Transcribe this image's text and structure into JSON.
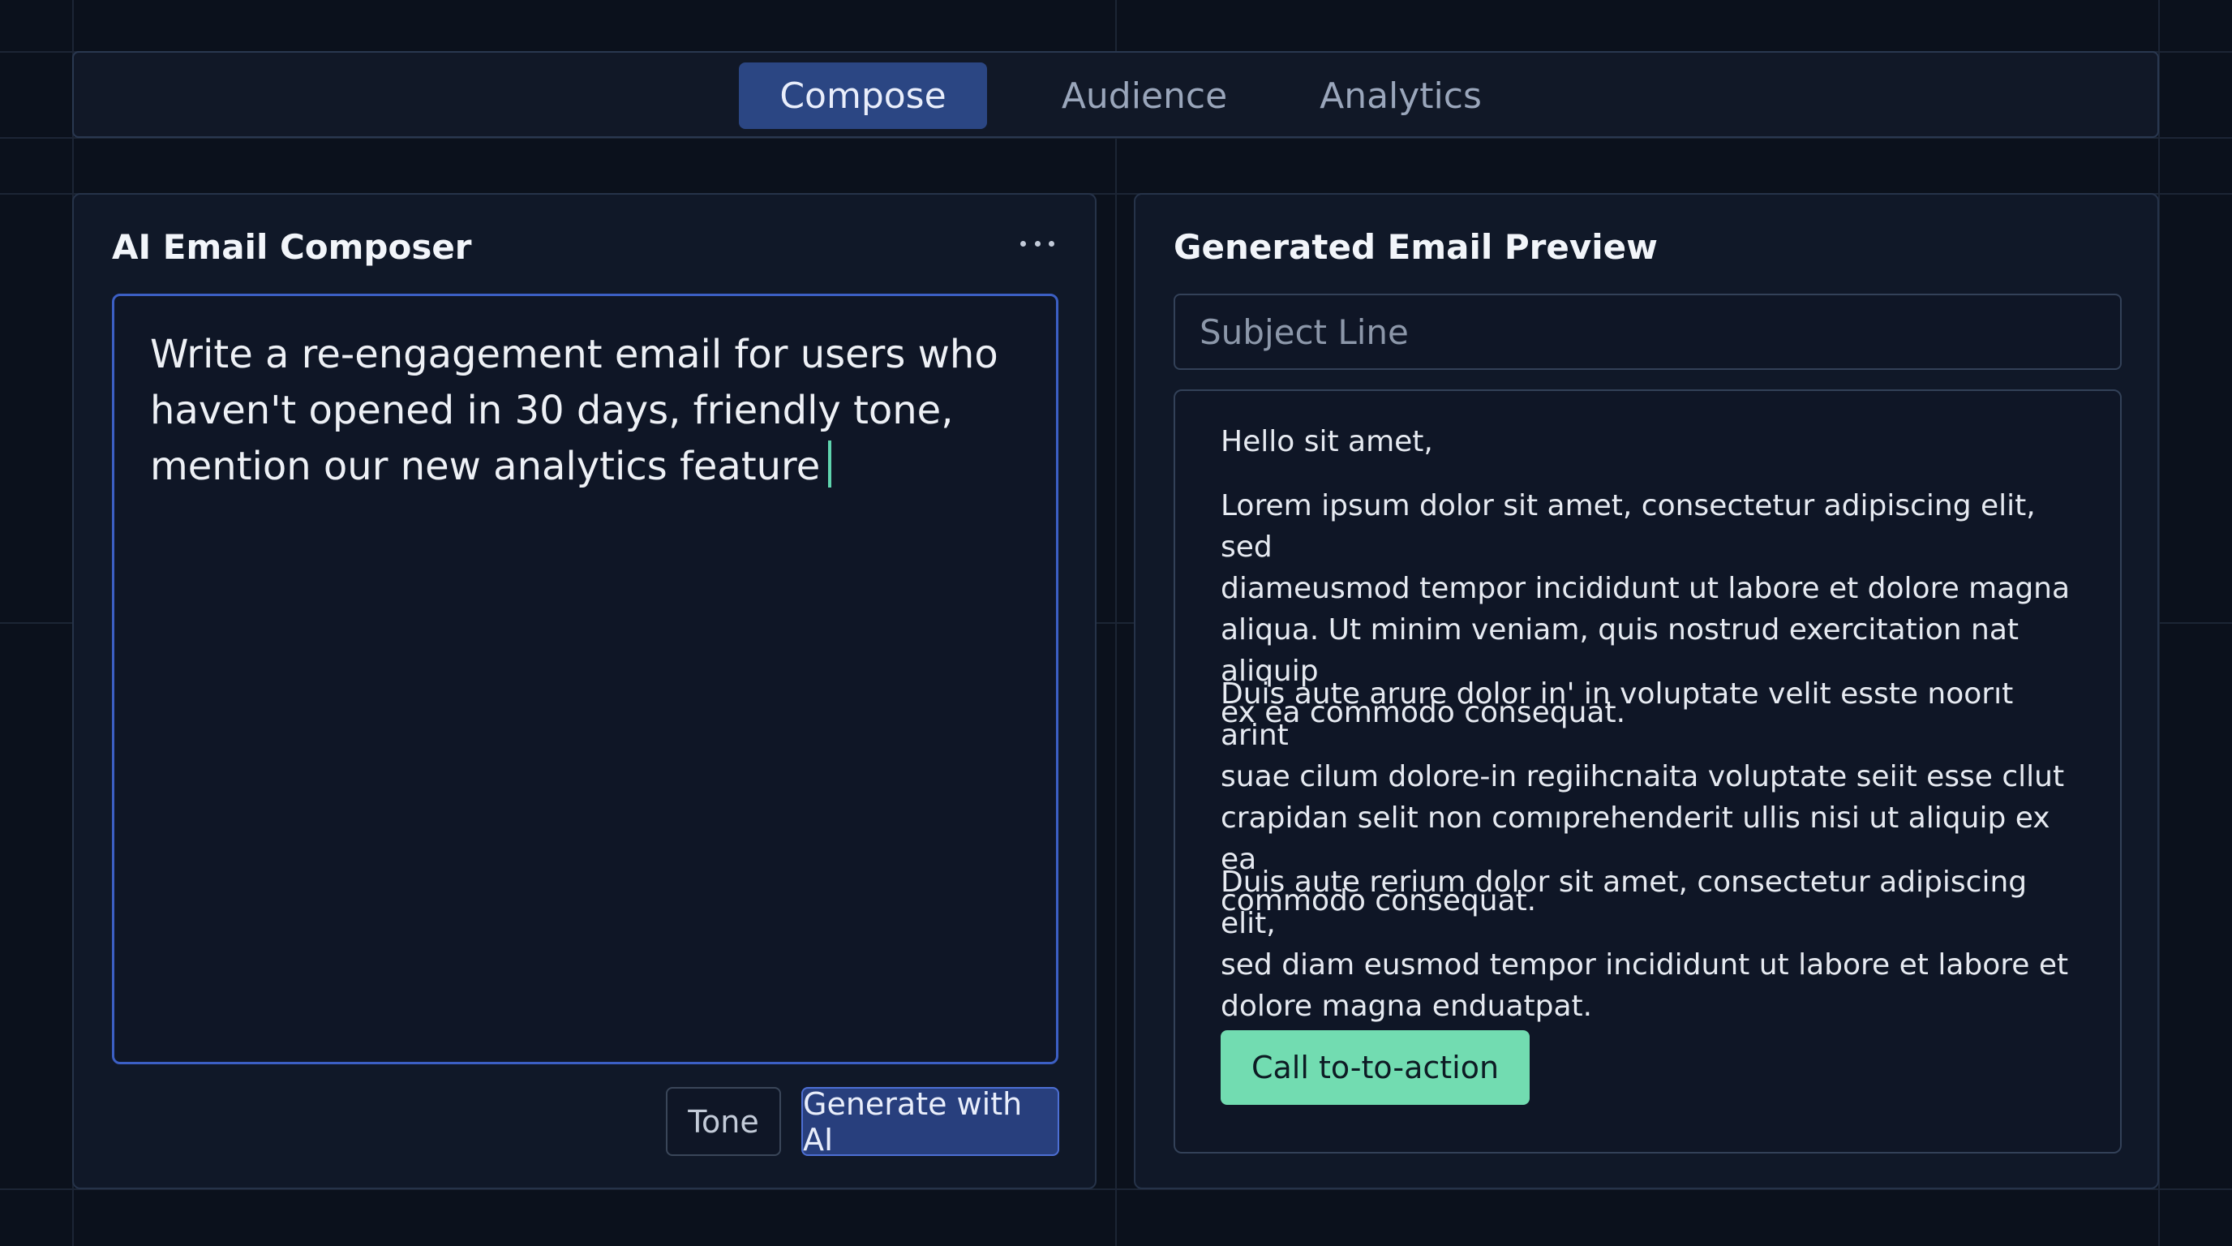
{
  "tabs": [
    {
      "label": "Compose",
      "active": true
    },
    {
      "label": "Audience",
      "active": false
    },
    {
      "label": "Analytics",
      "active": false
    }
  ],
  "composer": {
    "title": "AI Email Composer",
    "menu_icon": "more-horizontal-icon",
    "prompt_lines": [
      "Write a re-engagement email for users who",
      "haven't opened in 30 days, friendly tone,",
      "mention our new analytics feature"
    ],
    "tone_label": "Tone",
    "generate_label": "Generate with AI"
  },
  "preview": {
    "title": "Generated Email Preview",
    "subject_placeholder": "Subject Line",
    "greeting": "Hello sit amet,",
    "paragraph_1_lines": [
      "Lorem ipsum dolor sit amet, consectetur adipiscing elit, sed",
      "diameusmod tempor incididunt ut labore et dolore magna",
      "aliqua. Ut minim veniam, quis nostrud exercitation nat aliquip",
      "ex ea commodo consequat."
    ],
    "paragraph_2_lines": [
      "Duis aute arure dolor in' in voluptate velit esste noorıt arint",
      "suae cilum dolore-in regiihcnaita voluptate seiit esse cllut",
      "crapidan selit non comıprehenderit ullis nisi ut aliquip ex ea",
      "commodo consequat."
    ],
    "paragraph_3_lines": [
      "Duis aute rerium dolor sit amet, consectetur adipiscing elit,",
      "sed diam eusmod tempor incididunt ut labore et labore et",
      "dolore magna enduatpat."
    ],
    "cta_label": "Call to-to-action"
  },
  "colors": {
    "background": "#0b111c",
    "panel": "#101828",
    "active_tab": "#2b4683",
    "focus_border": "#3c5fc4",
    "caret": "#5fd4ae",
    "cta": "#72dcb1"
  }
}
